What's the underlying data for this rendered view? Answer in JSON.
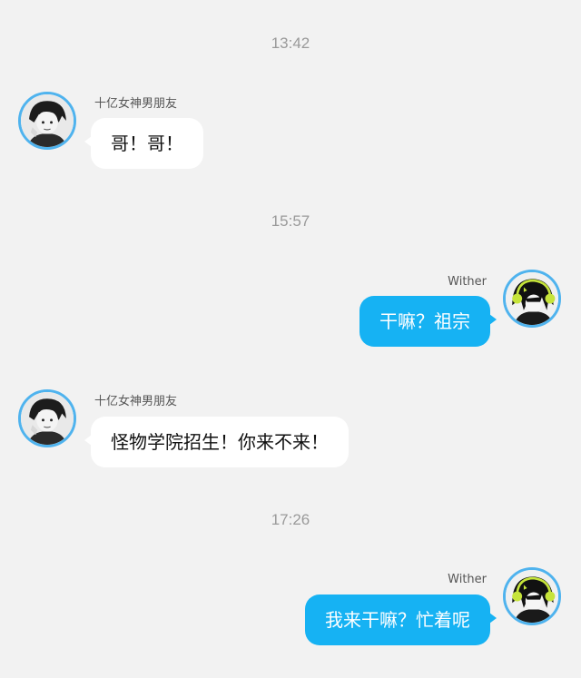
{
  "timestamps": [
    "13:42",
    "15:57",
    "17:26"
  ],
  "messages": [
    {
      "sender": "十亿女神男朋友",
      "text": "哥！哥！",
      "direction": "incoming",
      "avatar": "monochrome-boy-avatar"
    },
    {
      "sender": "Wither",
      "text": "干嘛？祖宗",
      "direction": "outgoing",
      "avatar": "green-headphones-avatar"
    },
    {
      "sender": "十亿女神男朋友",
      "text": "怪物学院招生！你来不来！",
      "direction": "incoming",
      "avatar": "monochrome-boy-avatar"
    },
    {
      "sender": "Wither",
      "text": "我来干嘛？忙着呢",
      "direction": "outgoing",
      "avatar": "green-headphones-avatar"
    }
  ],
  "colors": {
    "background": "#f2f2f2",
    "outgoing_bubble": "#16b2f3",
    "incoming_bubble": "#ffffff",
    "avatar_ring": "#4fb3ee",
    "timestamp_text": "#9a9a9a"
  }
}
